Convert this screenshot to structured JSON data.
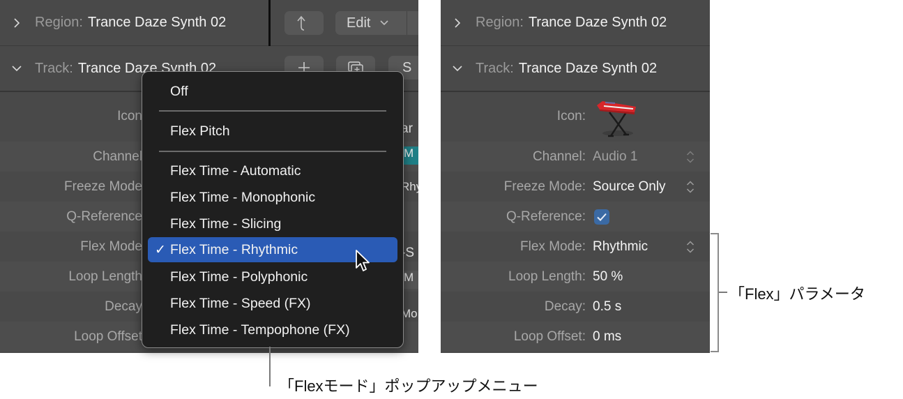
{
  "left_panel": {
    "region": {
      "label": "Region:",
      "value": "Trance Daze Synth 02",
      "expanded": false
    },
    "track": {
      "label": "Track:",
      "value": "Trance Daze Synth 02",
      "expanded": true
    },
    "toolbar": {
      "up_button_icon": "catch-arrow-icon",
      "edit_label": "Edit",
      "add_button_icon": "plus-icon",
      "duplicate_button_icon": "duplicate-track-icon",
      "s_label": "S"
    },
    "properties": [
      {
        "label": "Icon"
      },
      {
        "label": "Channel"
      },
      {
        "label": "Freeze Mode"
      },
      {
        "label": "Q-Reference"
      },
      {
        "label": "Flex Mode"
      },
      {
        "label": "Loop Length"
      },
      {
        "label": "Decay"
      },
      {
        "label": "Loop Offset"
      }
    ],
    "edge_fragments": {
      "icon_row": "ar",
      "channel_row": "M",
      "freeze_row": "Rhy",
      "flex_row": "-S",
      "loop_length_row": "M",
      "decay_row": "Mo"
    }
  },
  "popup_menu": {
    "items": [
      {
        "label": "Off",
        "selected": false
      },
      {
        "label": "Flex Pitch",
        "selected": false
      },
      {
        "label": "Flex Time - Automatic",
        "selected": false
      },
      {
        "label": "Flex Time - Monophonic",
        "selected": false
      },
      {
        "label": "Flex Time - Slicing",
        "selected": false
      },
      {
        "label": "Flex Time - Rhythmic",
        "selected": true
      },
      {
        "label": "Flex Time - Polyphonic",
        "selected": false
      },
      {
        "label": "Flex Time - Speed (FX)",
        "selected": false
      },
      {
        "label": "Flex Time - Tempophone (FX)",
        "selected": false
      }
    ],
    "check_glyph": "✓",
    "selected_color": "#2a5bb5"
  },
  "right_panel": {
    "region": {
      "label": "Region:",
      "value": "Trance Daze Synth 02",
      "expanded": false
    },
    "track": {
      "label": "Track:",
      "value": "Trance Daze Synth 02",
      "expanded": true
    },
    "properties": {
      "icon": {
        "label": "Icon:",
        "value_icon": "keyboard-on-stand-icon"
      },
      "channel": {
        "label": "Channel:",
        "value": "Audio 1"
      },
      "freeze_mode": {
        "label": "Freeze Mode:",
        "value": "Source Only"
      },
      "q_reference": {
        "label": "Q-Reference:",
        "checked": true
      },
      "flex_mode": {
        "label": "Flex Mode:",
        "value": "Rhythmic"
      },
      "loop_length": {
        "label": "Loop Length:",
        "value": "50 %"
      },
      "decay": {
        "label": "Decay:",
        "value": "0.5 s"
      },
      "loop_offset": {
        "label": "Loop Offset:",
        "value": "0 ms"
      }
    },
    "checkbox_color": "#3b6aa4"
  },
  "callouts": {
    "flex_params": "「Flex」パラメータ",
    "flex_mode_popup": "「Flexモード」ポップアップメニュー"
  }
}
